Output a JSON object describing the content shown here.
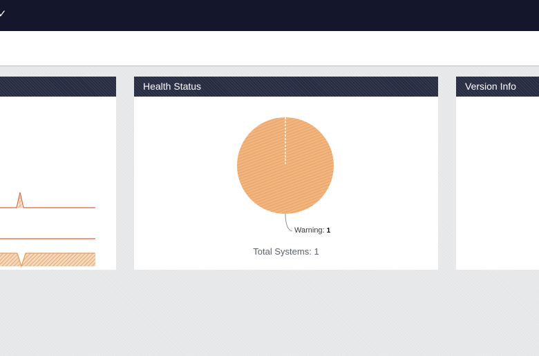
{
  "topbar": {
    "check_glyph": "✓"
  },
  "panels": {
    "health": {
      "title": "Health Status",
      "total_label": "Total Systems:",
      "total_value": "1"
    },
    "version": {
      "title": "Version Info"
    }
  },
  "chart_data": {
    "type": "pie",
    "slices": [
      {
        "label": "Warning:",
        "value": 1,
        "color": "#f2a868"
      }
    ]
  },
  "colors": {
    "topbar": "#14162b",
    "panel_header": "#252a40",
    "sparkline_red": "#d9623b",
    "sparkline_orange": "#e8a15c",
    "warning": "#f2a868"
  },
  "icons": {
    "topbar_left": "check-icon"
  }
}
